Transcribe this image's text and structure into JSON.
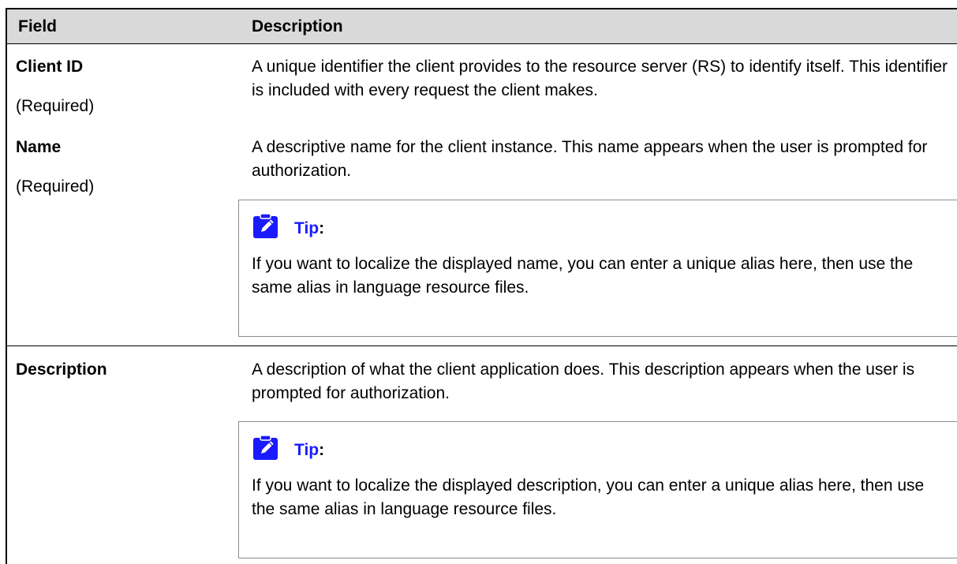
{
  "table": {
    "headers": {
      "field": "Field",
      "description": "Description"
    },
    "rows": [
      {
        "field": "Client ID",
        "required": "(Required)",
        "description": "A unique identifier the client provides to the resource server (RS) to identify itself. This identifier is included with every request the client makes."
      },
      {
        "field": "Name",
        "required": "(Required)",
        "description": "A descriptive name for the client instance. This name appears when the user is prompted for authorization.",
        "tip": {
          "label": "Tip",
          "colon": ":",
          "text": "If you want to localize the displayed name, you can enter a unique alias here, then use the same alias in language resource files."
        }
      },
      {
        "field": "Description",
        "description": "A description of what the client application does. This description appears when the user is prompted for authorization.",
        "tip": {
          "label": "Tip",
          "colon": ":",
          "text": "If you want to localize the displayed description, you can enter a unique alias here, then use the same alias in language resource files."
        }
      }
    ]
  },
  "colors": {
    "header_bg": "#d9d9d9",
    "tip_label": "#1a1aff",
    "tip_icon": "#1a1aff",
    "note_border": "#8c8c8c"
  },
  "icons": {
    "tip": "pencil-note-icon"
  }
}
